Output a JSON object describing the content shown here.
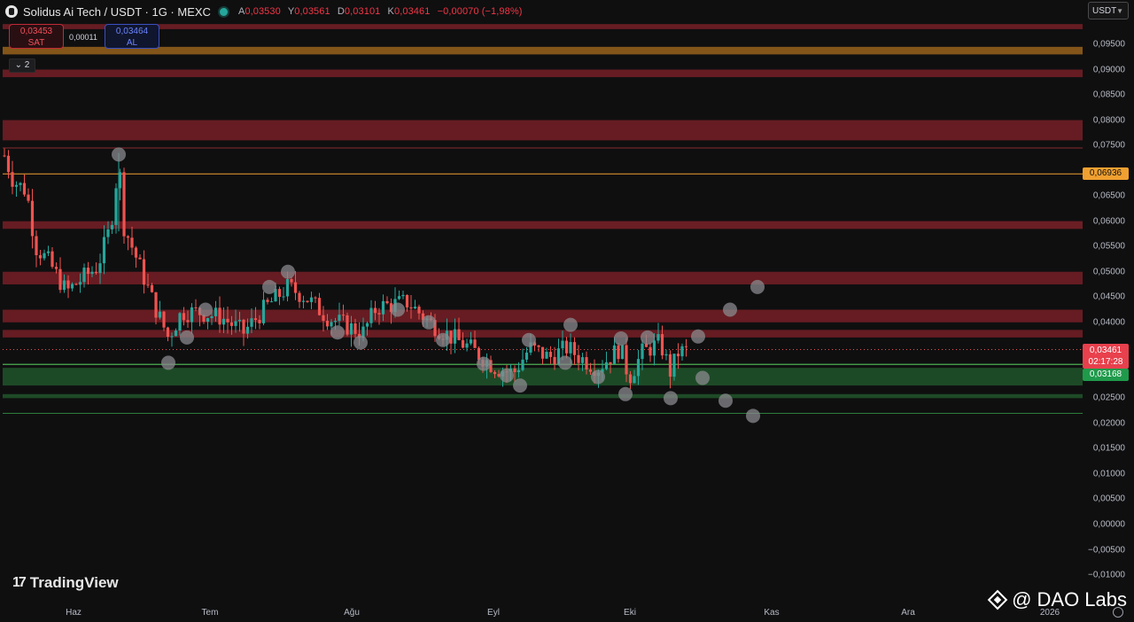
{
  "header": {
    "symbol": "Solidus Ai Tech / USDT · 1G · MEXC",
    "ohlc": {
      "open_key": "A",
      "open": "0,03530",
      "high_key": "Y",
      "high": "0,03561",
      "low_key": "D",
      "low": "0,03101",
      "close_key": "K",
      "close": "0,03461",
      "change": "−0,00070 (−1,98%)"
    }
  },
  "trade_panel": {
    "sell_price": "0,03453",
    "sell_label": "SAT",
    "spread": "0,00011",
    "buy_price": "0,03464",
    "buy_label": "AL"
  },
  "indicator_toggle": "⌄ 2",
  "currency_button": "USDT",
  "price_axis": {
    "ticks": [
      "0,09500",
      "0,09000",
      "0,08500",
      "0,08000",
      "0,07500",
      "0,06500",
      "0,06000",
      "0,05500",
      "0,05000",
      "0,04500",
      "0,04000",
      "0,02500",
      "0,02000",
      "0,01500",
      "0,01000",
      "0,00500",
      "0,00000",
      "−0,00500",
      "−0,01000"
    ],
    "label_orange": "0,06936",
    "label_last_price": "0,03461",
    "label_countdown": "02:17:28",
    "label_green": "0,03168"
  },
  "time_axis": [
    "Haz",
    "Tem",
    "Ağu",
    "Eyl",
    "Eki",
    "Kas",
    "Ara",
    "2026"
  ],
  "brand": "TradingView",
  "watermark": "@ DAO Labs",
  "colors": {
    "up": "#26a69a",
    "down": "#ef5350",
    "resistance_zone": "#6b1e24",
    "support_zone": "#1d4a26",
    "orange_line": "#f0a030",
    "green_line": "#4caf50"
  },
  "chart_data": {
    "type": "candlestick",
    "price_range": [
      -0.0115,
      0.0993
    ],
    "last_price": 0.03461,
    "horizontal_levels": [
      0.06936,
      0.03168
    ],
    "resistance_zones": [
      [
        0.098,
        0.099
      ],
      [
        0.09,
        0.0885
      ],
      [
        0.08,
        0.076
      ],
      [
        0.06,
        0.0585
      ],
      [
        0.05,
        0.0475
      ],
      [
        0.0425,
        0.04
      ],
      [
        0.0385,
        0.037
      ],
      [
        0.0945,
        0.093
      ]
    ],
    "support_zones": [
      [
        0.031,
        0.0275
      ],
      [
        0.0258,
        0.025
      ]
    ]
  }
}
